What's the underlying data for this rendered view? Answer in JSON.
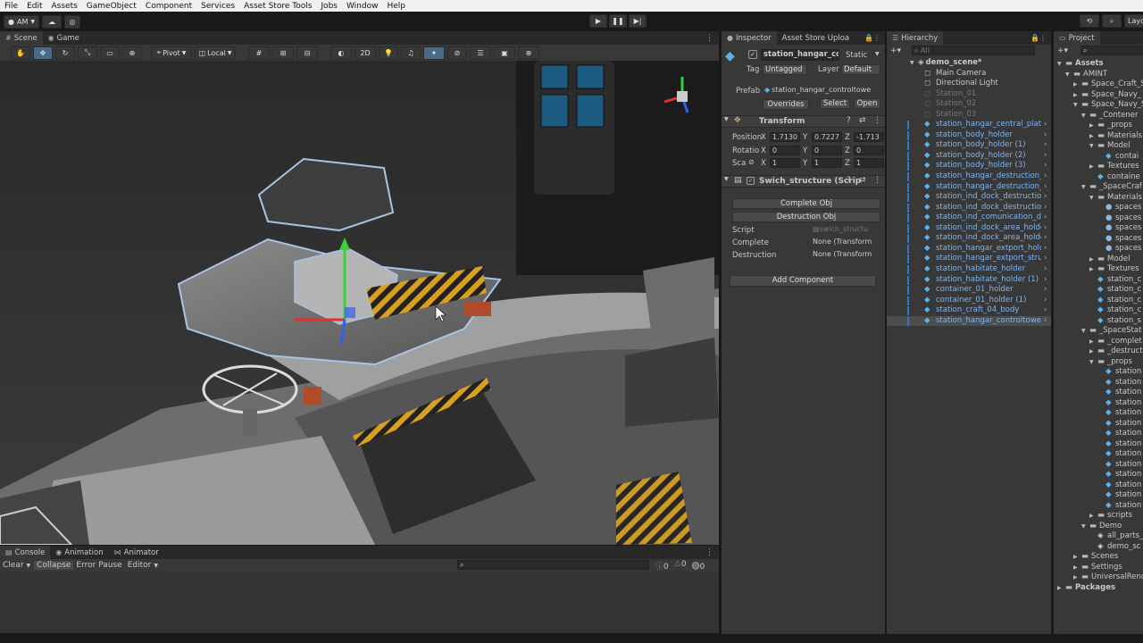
{
  "menu": [
    "File",
    "Edit",
    "Assets",
    "GameObject",
    "Component",
    "Services",
    "Asset Store Tools",
    "Jobs",
    "Window",
    "Help"
  ],
  "toolbar": {
    "account": "AM",
    "layout": "Layo"
  },
  "scene": {
    "tabs": [
      "Scene",
      "Game"
    ],
    "pivot": "Pivot",
    "local": "Local",
    "mode_2d": "2D"
  },
  "console": {
    "tabs": [
      "Console",
      "Animation",
      "Animator"
    ],
    "clear": "Clear",
    "collapse": "Collapse",
    "error_pause": "Error Pause",
    "editor": "Editor",
    "counts": [
      "0",
      "0",
      "0"
    ]
  },
  "inspector": {
    "tabs": [
      "Inspector",
      "Asset Store Uploa"
    ],
    "name": "station_hangar_co",
    "static": "Static",
    "tag_label": "Tag",
    "tag_value": "Untagged",
    "layer_label": "Layer",
    "layer_value": "Default",
    "prefab_label": "Prefab",
    "prefab_value": "station_hangar_controltowe",
    "overrides": "Overrides",
    "select": "Select",
    "open": "Open",
    "transform_title": "Transform",
    "position_label": "Position",
    "rotation_label": "Rotatio",
    "scale_label": "Sca",
    "position": [
      "1.7130",
      "0.7227",
      "-1.713"
    ],
    "rotation": [
      "0",
      "0",
      "0"
    ],
    "scale": [
      "1",
      "1",
      "1"
    ],
    "axes": [
      "X",
      "Y",
      "Z"
    ],
    "script_title": "Swich_structure (Scrip",
    "complete_obj": "Complete Obj",
    "destruction_obj": "Destruction Obj",
    "script_label": "Script",
    "script_value": "swich_structu",
    "complete_label": "Complete",
    "complete_value": "None (Transform",
    "destruction_label": "Destruction",
    "destruction_value": "None (Transform",
    "add_component": "Add Component"
  },
  "hierarchy": {
    "tab": "Hierarchy",
    "search_placeholder": "All",
    "scene": "demo_scene*",
    "items": [
      {
        "label": "Main Camera",
        "kind": "normal"
      },
      {
        "label": "Directional Light",
        "kind": "normal"
      },
      {
        "label": "Station_01",
        "kind": "disabled"
      },
      {
        "label": "Station_02",
        "kind": "disabled"
      },
      {
        "label": "Station_03",
        "kind": "disabled"
      },
      {
        "label": "station_hangar_central_platfo",
        "kind": "prefab"
      },
      {
        "label": "station_body_holder",
        "kind": "prefab"
      },
      {
        "label": "station_body_holder (1)",
        "kind": "prefab"
      },
      {
        "label": "station_body_holder (2)",
        "kind": "prefab"
      },
      {
        "label": "station_body_holder (3)",
        "kind": "prefab"
      },
      {
        "label": "station_hangar_destruction_h",
        "kind": "prefab"
      },
      {
        "label": "station_hangar_destruction_h",
        "kind": "prefab"
      },
      {
        "label": "station_ind_dock_destruction",
        "kind": "prefab"
      },
      {
        "label": "station_ind_dock_destruction",
        "kind": "prefab"
      },
      {
        "label": "station_ind_comunication_dis",
        "kind": "prefab"
      },
      {
        "label": "station_ind_dock_area_holder",
        "kind": "prefab"
      },
      {
        "label": "station_ind_dock_area_holder",
        "kind": "prefab"
      },
      {
        "label": "station_hangar_extport_holde",
        "kind": "prefab"
      },
      {
        "label": "station_hangar_extport_struct",
        "kind": "prefab"
      },
      {
        "label": "station_habitate_holder",
        "kind": "prefab"
      },
      {
        "label": "station_habitate_holder (1)",
        "kind": "prefab"
      },
      {
        "label": "container_01_holder",
        "kind": "prefab"
      },
      {
        "label": "container_01_holder (1)",
        "kind": "prefab"
      },
      {
        "label": "station_craft_04_body",
        "kind": "prefab"
      },
      {
        "label": "station_hangar_controltower_",
        "kind": "selected"
      }
    ]
  },
  "project": {
    "tab": "Project",
    "items": [
      {
        "label": "Assets",
        "indent": 0,
        "kind": "folder-open"
      },
      {
        "label": "AMINT",
        "indent": 1,
        "kind": "folder-open"
      },
      {
        "label": "Space_Craft_S",
        "indent": 2,
        "kind": "folder"
      },
      {
        "label": "Space_Navy_",
        "indent": 2,
        "kind": "folder"
      },
      {
        "label": "Space_Navy_S",
        "indent": 2,
        "kind": "folder-open"
      },
      {
        "label": "_Contener",
        "indent": 3,
        "kind": "folder-open"
      },
      {
        "label": "_props",
        "indent": 4,
        "kind": "folder"
      },
      {
        "label": "Materials",
        "indent": 4,
        "kind": "folder"
      },
      {
        "label": "Model",
        "indent": 4,
        "kind": "folder-open"
      },
      {
        "label": "contai",
        "indent": 5,
        "kind": "prefab"
      },
      {
        "label": "Textures",
        "indent": 4,
        "kind": "folder"
      },
      {
        "label": "containe",
        "indent": 4,
        "kind": "prefab"
      },
      {
        "label": "_SpaceCraf",
        "indent": 3,
        "kind": "folder-open"
      },
      {
        "label": "Materials",
        "indent": 4,
        "kind": "folder-open"
      },
      {
        "label": "spaces",
        "indent": 5,
        "kind": "material"
      },
      {
        "label": "spaces",
        "indent": 5,
        "kind": "material"
      },
      {
        "label": "spaces",
        "indent": 5,
        "kind": "material"
      },
      {
        "label": "spaces",
        "indent": 5,
        "kind": "material"
      },
      {
        "label": "spaces",
        "indent": 5,
        "kind": "material"
      },
      {
        "label": "Model",
        "indent": 4,
        "kind": "folder"
      },
      {
        "label": "Textures",
        "indent": 4,
        "kind": "folder"
      },
      {
        "label": "station_c",
        "indent": 4,
        "kind": "prefab"
      },
      {
        "label": "station_c",
        "indent": 4,
        "kind": "prefab"
      },
      {
        "label": "station_c",
        "indent": 4,
        "kind": "prefab"
      },
      {
        "label": "station_c",
        "indent": 4,
        "kind": "prefab"
      },
      {
        "label": "station_s",
        "indent": 4,
        "kind": "prefab"
      },
      {
        "label": "_SpaceStat",
        "indent": 3,
        "kind": "folder-open"
      },
      {
        "label": "_complet",
        "indent": 4,
        "kind": "folder"
      },
      {
        "label": "_destruct",
        "indent": 4,
        "kind": "folder"
      },
      {
        "label": "_props",
        "indent": 4,
        "kind": "folder-open"
      },
      {
        "label": "station",
        "indent": 5,
        "kind": "prefab"
      },
      {
        "label": "station",
        "indent": 5,
        "kind": "prefab"
      },
      {
        "label": "station",
        "indent": 5,
        "kind": "prefab"
      },
      {
        "label": "station",
        "indent": 5,
        "kind": "prefab"
      },
      {
        "label": "station",
        "indent": 5,
        "kind": "prefab"
      },
      {
        "label": "station",
        "indent": 5,
        "kind": "prefab"
      },
      {
        "label": "station",
        "indent": 5,
        "kind": "prefab"
      },
      {
        "label": "station",
        "indent": 5,
        "kind": "prefab"
      },
      {
        "label": "station",
        "indent": 5,
        "kind": "prefab"
      },
      {
        "label": "station",
        "indent": 5,
        "kind": "prefab"
      },
      {
        "label": "station",
        "indent": 5,
        "kind": "prefab"
      },
      {
        "label": "station",
        "indent": 5,
        "kind": "prefab"
      },
      {
        "label": "station",
        "indent": 5,
        "kind": "prefab"
      },
      {
        "label": "station",
        "indent": 5,
        "kind": "prefab"
      },
      {
        "label": "scripts",
        "indent": 4,
        "kind": "folder"
      },
      {
        "label": "Demo",
        "indent": 3,
        "kind": "folder-open"
      },
      {
        "label": "all_parts_",
        "indent": 4,
        "kind": "scene"
      },
      {
        "label": "demo_sc",
        "indent": 4,
        "kind": "scene"
      },
      {
        "label": "Scenes",
        "indent": 2,
        "kind": "folder"
      },
      {
        "label": "Settings",
        "indent": 2,
        "kind": "folder"
      },
      {
        "label": "UniversalRender",
        "indent": 2,
        "kind": "folder"
      },
      {
        "label": "Packages",
        "indent": 0,
        "kind": "folder"
      }
    ]
  },
  "colors": {
    "accent": "#7fb6f0",
    "prefab": "#5ab1ec",
    "selected": "#2c5d87",
    "panel": "#383838",
    "tabbar": "#282828"
  }
}
